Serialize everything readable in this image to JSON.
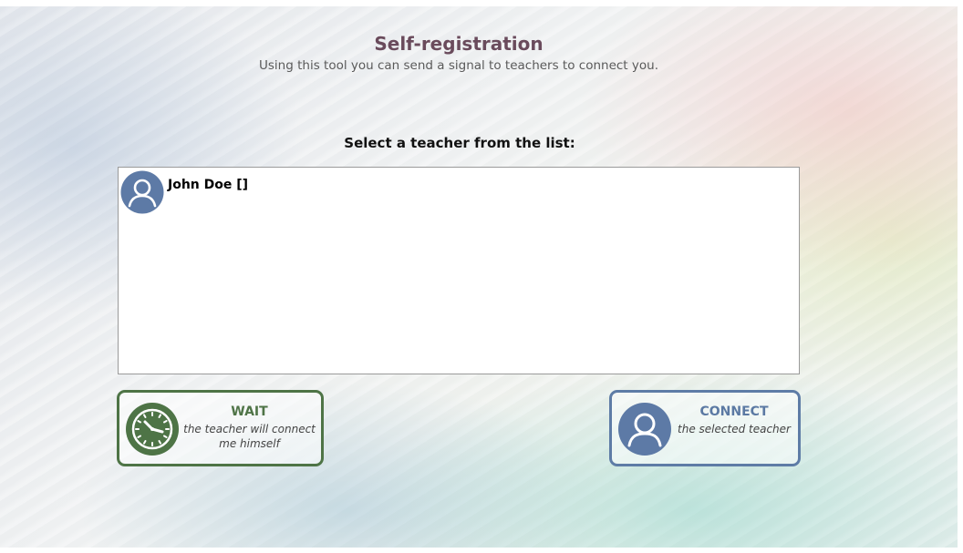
{
  "header": {
    "title": "Self-registration",
    "subtitle": "Using this tool you can send a signal to teachers to connect you."
  },
  "teacher_list": {
    "heading": "Select a teacher from the list:",
    "items": [
      {
        "name": "John Doe []",
        "icon": "user-avatar-icon"
      }
    ]
  },
  "actions": {
    "wait": {
      "title": "WAIT",
      "description": "the teacher will connect me himself",
      "icon": "clock-icon",
      "color": "#4e7446"
    },
    "connect": {
      "title": "CONNECT",
      "description": "the selected teacher",
      "icon": "user-avatar-icon",
      "color": "#5e7ca6"
    }
  }
}
